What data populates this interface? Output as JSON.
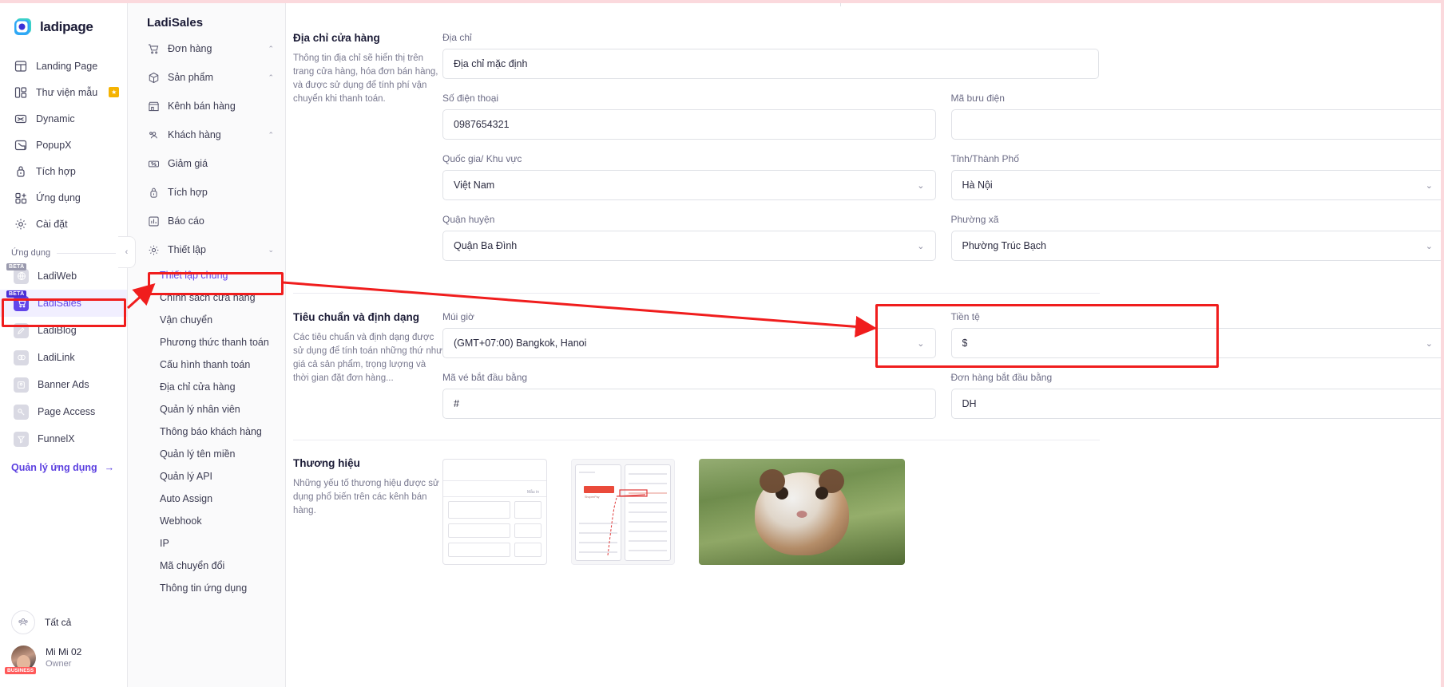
{
  "brand": {
    "name": "ladipage"
  },
  "rail": {
    "items": [
      {
        "label": "Landing Page",
        "icon": "layout-icon",
        "badge": ""
      },
      {
        "label": "Thư viện mẫu",
        "icon": "library-icon",
        "badge": "★"
      },
      {
        "label": "Dynamic",
        "icon": "shuffle-icon",
        "badge": ""
      },
      {
        "label": "PopupX",
        "icon": "popup-icon",
        "badge": ""
      },
      {
        "label": "Tích hợp",
        "icon": "plug-icon",
        "badge": ""
      },
      {
        "label": "Ứng dụng",
        "icon": "apps-icon",
        "badge": ""
      },
      {
        "label": "Cài đặt",
        "icon": "gear-icon",
        "badge": ""
      }
    ],
    "apps_section_label": "Ứng dụng",
    "apps": [
      {
        "label": "LadiWeb",
        "beta": "BETA",
        "glyph": "⊕",
        "selected": false
      },
      {
        "label": "LadiSales",
        "beta": "BETA",
        "glyph": "Ὥ2",
        "selected": true
      },
      {
        "label": "LadiBlog",
        "beta": "",
        "glyph": "✎",
        "selected": false
      },
      {
        "label": "LadiLink",
        "beta": "",
        "glyph": "∞",
        "selected": false
      },
      {
        "label": "Banner Ads",
        "beta": "",
        "glyph": "▣",
        "selected": false
      },
      {
        "label": "Page Access",
        "beta": "",
        "glyph": "⚷",
        "selected": false
      },
      {
        "label": "FunnelX",
        "beta": "",
        "glyph": "≣",
        "selected": false
      }
    ],
    "manage_apps": "Quản lý ứng dụng",
    "manage_apps_arrow": "→",
    "all_label": "Tất cả",
    "user_name": "Mi Mi 02",
    "user_role": "Owner",
    "user_badge": "BUSINESS",
    "collapse_icon": "‹"
  },
  "subnav": {
    "title": "LadiSales",
    "groups": [
      {
        "label": "Đơn hàng",
        "icon": "cart-icon",
        "chevron": "⌃"
      },
      {
        "label": "Sản phẩm",
        "icon": "box-icon",
        "chevron": "⌃"
      },
      {
        "label": "Kênh bán hàng",
        "icon": "store-icon",
        "chevron": ""
      },
      {
        "label": "Khách hàng",
        "icon": "customers-icon",
        "chevron": "⌃"
      },
      {
        "label": "Giảm giá",
        "icon": "discount-icon",
        "chevron": ""
      },
      {
        "label": "Tích hợp",
        "icon": "plug-icon",
        "chevron": ""
      },
      {
        "label": "Báo cáo",
        "icon": "report-icon",
        "chevron": ""
      },
      {
        "label": "Thiết lập",
        "icon": "gear-icon",
        "chevron": "⌄"
      }
    ],
    "settings_items": [
      {
        "label": "Thiết lập chung",
        "active": true
      },
      {
        "label": "Chính sách cửa hàng",
        "active": false
      },
      {
        "label": "Vận chuyển",
        "active": false
      },
      {
        "label": "Phương thức thanh toán",
        "active": false
      },
      {
        "label": "Cấu hình thanh toán",
        "active": false
      },
      {
        "label": "Địa chỉ cửa hàng",
        "active": false
      },
      {
        "label": "Quản lý nhân viên",
        "active": false
      },
      {
        "label": "Thông báo khách hàng",
        "active": false
      },
      {
        "label": "Quản lý tên miền",
        "active": false
      },
      {
        "label": "Quản lý API",
        "active": false
      },
      {
        "label": "Auto Assign",
        "active": false
      },
      {
        "label": "Webhook",
        "active": false
      },
      {
        "label": "IP",
        "active": false
      },
      {
        "label": "Mã chuyển đổi",
        "active": false
      },
      {
        "label": "Thông tin ứng dụng",
        "active": false
      }
    ]
  },
  "main": {
    "address_section": {
      "title": "Địa chỉ cửa hàng",
      "description": "Thông tin địa chỉ sẽ hiển thị trên trang cửa hàng, hóa đơn bán hàng, và được sử dụng để tính phí vận chuyển khi thanh toán.",
      "fields": {
        "address_label": "Địa chỉ",
        "address_value": "Địa chỉ mặc định",
        "phone_label": "Số điện thoại",
        "phone_value": "0987654321",
        "postal_label": "Mã bưu điện",
        "postal_value": "",
        "country_label": "Quốc gia/ Khu vực",
        "country_value": "Việt Nam",
        "province_label": "Tỉnh/Thành Phố",
        "province_value": "Hà Nội",
        "district_label": "Quận huyện",
        "district_value": "Quận Ba Đình",
        "ward_label": "Phường xã",
        "ward_value": "Phường Trúc Bạch"
      }
    },
    "format_section": {
      "title": "Tiêu chuẩn và định dạng",
      "description": "Các tiêu chuẩn và định dạng được sử dụng để tính toán những thứ như giá cả sản phẩm, trọng lượng và thời gian đặt đơn hàng...",
      "fields": {
        "timezone_label": "Múi giờ",
        "timezone_value": "(GMT+07:00) Bangkok, Hanoi",
        "currency_label": "Tiền tệ",
        "currency_value": "$",
        "ticket_prefix_label": "Mã vé bắt đầu bằng",
        "ticket_prefix_value": "#",
        "order_prefix_label": "Đơn hàng bắt đầu bằng",
        "order_prefix_value": "DH"
      }
    },
    "brand_section": {
      "title": "Thương hiệu",
      "description": "Những yếu tố thương hiệu được sử dụng phổ biến trên các kênh bán hàng.",
      "thumb_labels": {
        "t1": "Mẫu in",
        "t2": "ShopeePay",
        "t3": "hamster-photo"
      }
    }
  },
  "annotations": {
    "box_ladisales": "highlight-ladisales",
    "box_thiet_lap_chung": "highlight-thiet-lap-chung",
    "box_currency": "highlight-currency",
    "arrow_color": "#f01d1d"
  }
}
